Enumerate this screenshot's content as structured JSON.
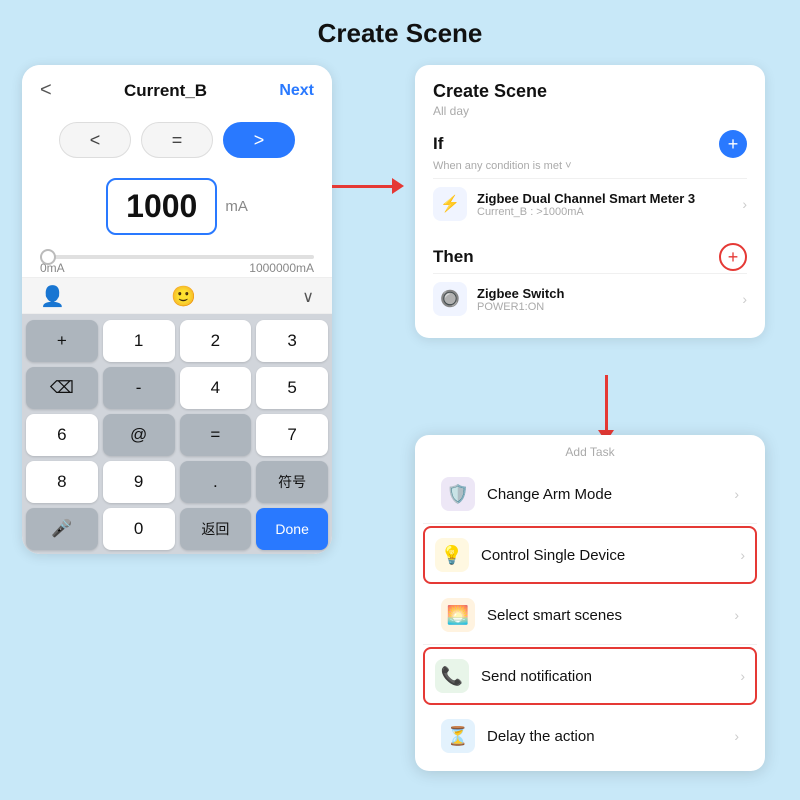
{
  "page": {
    "title": "Create Scene",
    "bg": "#c8e8f8"
  },
  "left_panel": {
    "back": "<",
    "title": "Current_B",
    "next": "Next",
    "cmp_less": "<",
    "cmp_equal": "=",
    "cmp_greater": ">",
    "value": "1000",
    "unit": "mA",
    "slider_min": "0mA",
    "slider_max": "1000000mA",
    "keys": [
      "+",
      "1",
      "2",
      "3",
      "⌫",
      "-",
      "4",
      "5",
      "6",
      "@",
      "=",
      "7",
      "8",
      "9",
      ".",
      "符号",
      "🎤",
      "0",
      "返回",
      "Done"
    ]
  },
  "right_top": {
    "title": "Create Scene",
    "subtitle": "All day",
    "if_label": "If",
    "if_condition": "When any condition is met ˅",
    "device1_name": "Zigbee Dual Channel Smart Meter 3",
    "device1_desc": "Current_B : >1000mA",
    "then_label": "Then",
    "device2_name": "Zigbee Switch",
    "device2_desc": "POWER1:ON"
  },
  "right_bottom": {
    "add_task_label": "Add Task",
    "items": [
      {
        "id": "arm",
        "label": "Change Arm Mode",
        "icon": "🛡️",
        "icon_class": "icon-purple",
        "highlighted": false
      },
      {
        "id": "device",
        "label": "Control Single Device",
        "icon": "💡",
        "icon_class": "icon-yellow",
        "highlighted": true
      },
      {
        "id": "scene",
        "label": "Select smart scenes",
        "icon": "🌅",
        "icon_class": "icon-orange",
        "highlighted": false
      },
      {
        "id": "notify",
        "label": "Send notification",
        "icon": "📞",
        "icon_class": "icon-green",
        "highlighted": true
      },
      {
        "id": "delay",
        "label": "Delay the action",
        "icon": "⏳",
        "icon_class": "icon-blue",
        "highlighted": false
      }
    ]
  }
}
